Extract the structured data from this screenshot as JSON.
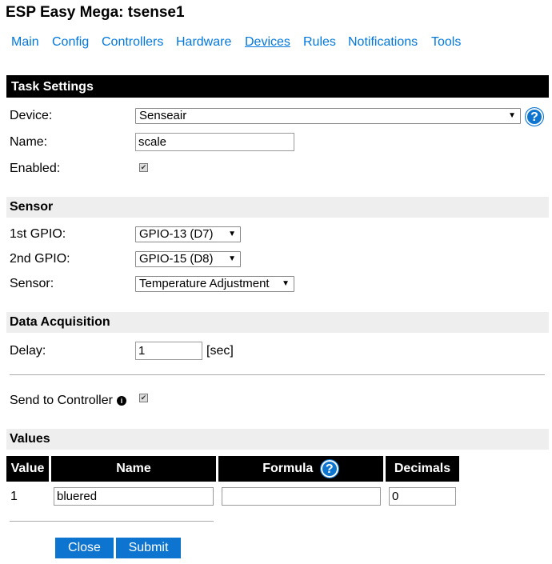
{
  "page": {
    "title": "ESP Easy Mega: tsense1"
  },
  "nav": [
    "Main",
    "Config",
    "Controllers",
    "Hardware",
    "Devices",
    "Rules",
    "Notifications",
    "Tools"
  ],
  "task_settings": {
    "header": "Task Settings",
    "device_label": "Device:",
    "device_value": "Senseair",
    "name_label": "Name:",
    "name_value": "scale",
    "enabled_label": "Enabled:",
    "enabled": true
  },
  "sensor": {
    "header": "Sensor",
    "gpio1_label": "1st GPIO:",
    "gpio1_value": "GPIO-13 (D7)",
    "gpio2_label": "2nd GPIO:",
    "gpio2_value": "GPIO-15 (D8)",
    "sensor_label": "Sensor:",
    "sensor_value": "Temperature Adjustment"
  },
  "data_acquisition": {
    "header": "Data Acquisition",
    "delay_label": "Delay:",
    "delay_value": "1",
    "delay_unit": "[sec]",
    "send_label": "Send to Controller",
    "send_enabled": true
  },
  "values": {
    "header": "Values",
    "columns": [
      "Value",
      "Name",
      "Formula",
      "Decimals"
    ],
    "rows": [
      {
        "index": "1",
        "name": "bluered",
        "formula": "",
        "decimals": "0"
      }
    ]
  },
  "buttons": {
    "close": "Close",
    "submit": "Submit"
  },
  "icons": {
    "help": "?",
    "info": "i",
    "check": "✔",
    "dropdown": "▼"
  },
  "colors": {
    "link": "#0077dd",
    "button": "#0d74cf",
    "header_bar": "#000000",
    "section_bar": "#eeeeee"
  }
}
